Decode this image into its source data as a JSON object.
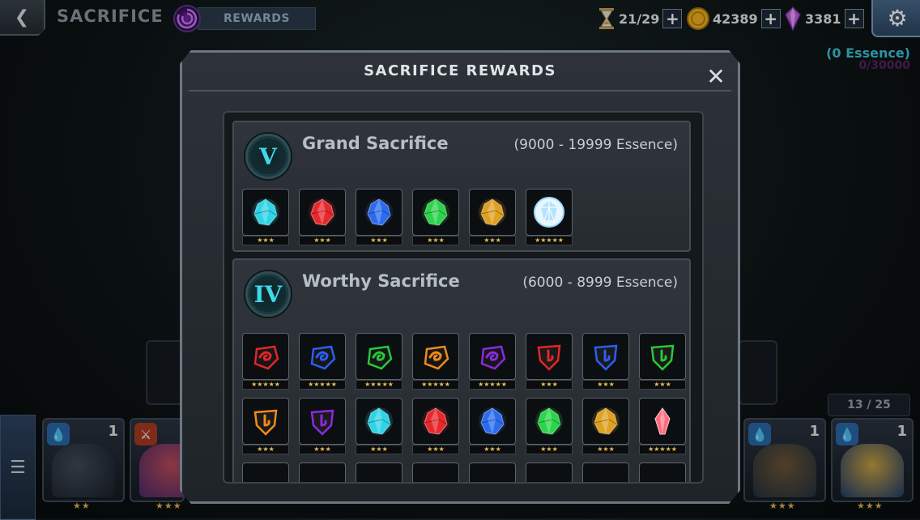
{
  "header": {
    "back_icon": "back-arrow-icon",
    "title": "SACRIFICE",
    "rewards_tab_label": "REWARDS",
    "settings_icon": "gear-icon"
  },
  "resources": {
    "energy": {
      "value": "21/29",
      "icon": "hourglass-icon"
    },
    "gold": {
      "value": "42389",
      "icon": "gold-coin-icon"
    },
    "units": {
      "value": "3381",
      "icon": "crystal-icon"
    }
  },
  "essence": {
    "label": "(0 Essence)",
    "progress": "0/30000"
  },
  "modal": {
    "title": "SACRIFICE REWARDS",
    "close_icon": "close-icon",
    "tiers": [
      {
        "numeral": "V",
        "name": "Grand Sacrifice",
        "range": "(9000 - 19999 Essence)",
        "rows": [
          [
            {
              "type": "crystal",
              "color": "#2fd4e6",
              "stars": "★★★"
            },
            {
              "type": "crystal",
              "color": "#e8282c",
              "stars": "★★★"
            },
            {
              "type": "crystal",
              "color": "#2a6cf0",
              "stars": "★★★"
            },
            {
              "type": "crystal",
              "color": "#2bd54a",
              "stars": "★★★"
            },
            {
              "type": "crystal",
              "color": "#e0a020",
              "stars": "★★★"
            },
            {
              "type": "gem",
              "color": "#9fd8ff",
              "stars": "★★★★★"
            }
          ]
        ]
      },
      {
        "numeral": "IV",
        "name": "Worthy Sacrifice",
        "range": "(6000 - 8999 Essence)",
        "rows": [
          [
            {
              "type": "shard",
              "color": "#e2262a",
              "stars": "★★★★★"
            },
            {
              "type": "shard",
              "color": "#2a5ef0",
              "stars": "★★★★★"
            },
            {
              "type": "shard",
              "color": "#28c83a",
              "stars": "★★★★★"
            },
            {
              "type": "shard",
              "color": "#f08a1c",
              "stars": "★★★★★"
            },
            {
              "type": "shard",
              "color": "#8a2ae0",
              "stars": "★★★★★"
            },
            {
              "type": "shardb",
              "color": "#e2262a",
              "stars": "★★★"
            },
            {
              "type": "shardb",
              "color": "#2a5ef0",
              "stars": "★★★"
            },
            {
              "type": "shardb",
              "color": "#28c83a",
              "stars": "★★★"
            }
          ],
          [
            {
              "type": "shardb",
              "color": "#f08a1c",
              "stars": "★★★"
            },
            {
              "type": "shardb",
              "color": "#8a2ae0",
              "stars": "★★★"
            },
            {
              "type": "crystal",
              "color": "#2fd4e6",
              "stars": "★★★"
            },
            {
              "type": "crystal",
              "color": "#e8282c",
              "stars": "★★★"
            },
            {
              "type": "crystal",
              "color": "#2a6cf0",
              "stars": "★★★"
            },
            {
              "type": "crystal",
              "color": "#2bd54a",
              "stars": "★★★"
            },
            {
              "type": "crystal",
              "color": "#e0a020",
              "stars": "★★★"
            },
            {
              "type": "pink",
              "color": "#ff6a7a",
              "stars": "★★★★★"
            }
          ]
        ]
      }
    ]
  },
  "roster": {
    "page_counter": "13 / 25",
    "menu_icon": "menu-icon",
    "heroes": [
      {
        "count": "1",
        "stars": "★★",
        "badge": "water-class-icon"
      },
      {
        "count": "",
        "stars": "★★★",
        "badge": "fire-class-icon"
      },
      {
        "count": "1",
        "stars": "★★★",
        "badge": "water-class-icon"
      },
      {
        "count": "1",
        "stars": "★★★",
        "badge": "water-class-icon"
      }
    ]
  }
}
